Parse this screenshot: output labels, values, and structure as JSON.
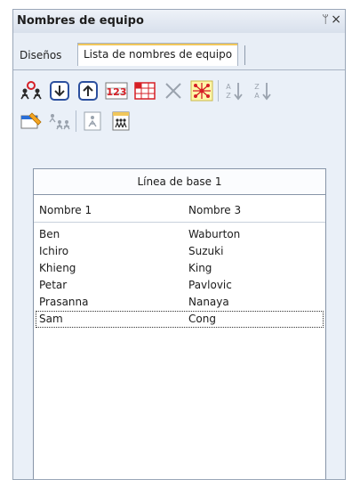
{
  "panel": {
    "title": "Nombres de equipo",
    "pin_glyph": "ᛘ",
    "close_glyph": "×"
  },
  "tabs": [
    {
      "label": "Diseños",
      "active": false
    },
    {
      "label": "Lista de nombres de equipo",
      "active": true
    }
  ],
  "toolbar": {
    "row1": [
      "add-member-icon",
      "move-down-icon",
      "move-up-icon",
      "numbering-icon",
      "delete-icon",
      "group-icon",
      "sort-ascending-icon",
      "sort-descending-icon"
    ],
    "row2": [
      "edit-list-icon",
      "team-icon",
      "single-member-icon",
      "multi-member-icon"
    ],
    "numbering_text": "123"
  },
  "table": {
    "group_header": "Línea de base 1",
    "columns": [
      "Nombre 1",
      "Nombre 3"
    ],
    "rows": [
      [
        "Ben",
        "Waburton"
      ],
      [
        "Ichiro",
        "Suzuki"
      ],
      [
        "Khieng",
        "King"
      ],
      [
        "Petar",
        "Pavlovic"
      ],
      [
        "Prasanna",
        "Nanaya"
      ],
      [
        "Sam",
        "Cong"
      ]
    ],
    "selected_row": 5
  },
  "colors": {
    "active_tab_accent": "#f1c75b",
    "panel_bg": "#e8eef6",
    "icon_red": "#d61f26",
    "icon_blue": "#2b4f9e"
  }
}
